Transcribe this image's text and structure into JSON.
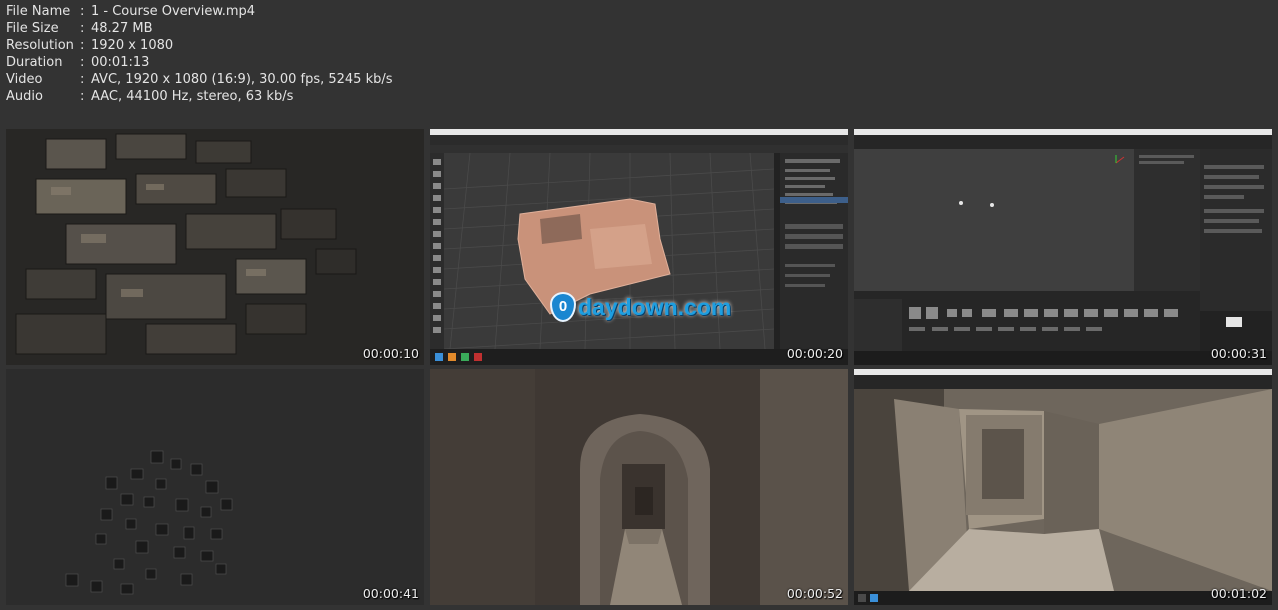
{
  "file_info": [
    {
      "key": "File Name",
      "value": "1 - Course Overview.mp4"
    },
    {
      "key": "File Size",
      "value": "48.27 MB"
    },
    {
      "key": "Resolution",
      "value": "1920 x 1080"
    },
    {
      "key": "Duration",
      "value": "00:01:13"
    },
    {
      "key": "Video",
      "value": "AVC, 1920 x 1080 (16:9), 30.00 fps, 5245 kb/s"
    },
    {
      "key": "Audio",
      "value": "AAC, 44100 Hz, stereo, 63 kb/s"
    }
  ],
  "separator": ":",
  "thumbnails": [
    {
      "timestamp": "00:00:10",
      "scene": "scattered-3d-room-blocks"
    },
    {
      "timestamp": "00:00:20",
      "scene": "blender-viewport-room-model"
    },
    {
      "timestamp": "00:00:31",
      "scene": "unreal-editor-empty-level"
    },
    {
      "timestamp": "00:00:41",
      "scene": "scattered-small-blocks"
    },
    {
      "timestamp": "00:00:52",
      "scene": "arched-corridor"
    },
    {
      "timestamp": "00:01:02",
      "scene": "unreal-editor-room-interior"
    }
  ],
  "watermark": {
    "text": "daydown.com",
    "badge": "0"
  },
  "colors": {
    "background": "#333333",
    "text": "#e4e4e4",
    "watermark": "#1e9ee0"
  }
}
